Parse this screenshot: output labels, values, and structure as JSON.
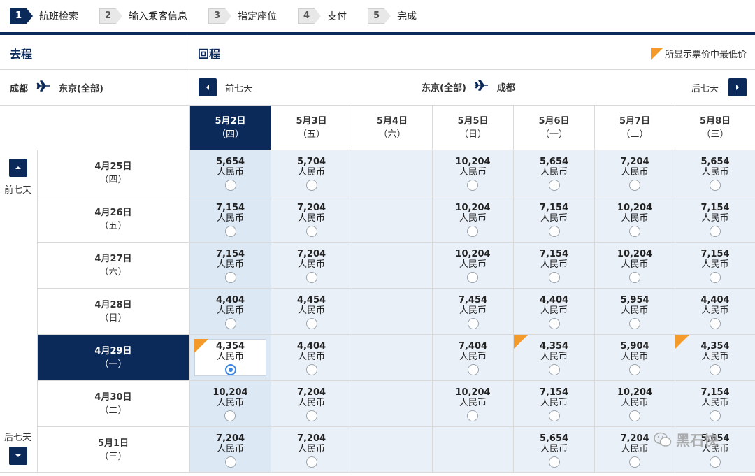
{
  "steps": [
    {
      "num": "1",
      "label": "航班检索",
      "active": true
    },
    {
      "num": "2",
      "label": "输入乘客信息",
      "active": false
    },
    {
      "num": "3",
      "label": "指定座位",
      "active": false
    },
    {
      "num": "4",
      "label": "支付",
      "active": false
    },
    {
      "num": "5",
      "label": "完成",
      "active": false
    }
  ],
  "outbound": {
    "title": "去程",
    "from": "成都",
    "to": "东京(全部)"
  },
  "return": {
    "title": "回程",
    "from": "东京(全部)",
    "to": "成都",
    "prev_label": "前七天",
    "next_label": "后七天"
  },
  "legend": {
    "label": "所显示票价中最低价",
    "color": "#f39a2b"
  },
  "side": {
    "prev_label": "前七天",
    "next_label": "后七天"
  },
  "return_dates": [
    {
      "date": "5月2日",
      "weekday": "（四）",
      "active": true
    },
    {
      "date": "5月3日",
      "weekday": "（五）",
      "active": false
    },
    {
      "date": "5月4日",
      "weekday": "（六）",
      "active": false
    },
    {
      "date": "5月5日",
      "weekday": "（日）",
      "active": false
    },
    {
      "date": "5月6日",
      "weekday": "（一）",
      "active": false
    },
    {
      "date": "5月7日",
      "weekday": "（二）",
      "active": false
    },
    {
      "date": "5月8日",
      "weekday": "（三）",
      "active": false
    }
  ],
  "currency": "人民币",
  "rows": [
    {
      "date": "4月25日",
      "weekday": "（四）",
      "active": false,
      "prices": [
        "5,654",
        "5,704",
        "",
        "10,204",
        "5,654",
        "7,204",
        "5,654"
      ]
    },
    {
      "date": "4月26日",
      "weekday": "（五）",
      "active": false,
      "prices": [
        "7,154",
        "7,204",
        "",
        "10,204",
        "7,154",
        "10,204",
        "7,154"
      ]
    },
    {
      "date": "4月27日",
      "weekday": "（六）",
      "active": false,
      "prices": [
        "7,154",
        "7,204",
        "",
        "10,204",
        "7,154",
        "10,204",
        "7,154"
      ]
    },
    {
      "date": "4月28日",
      "weekday": "（日）",
      "active": false,
      "prices": [
        "4,404",
        "4,454",
        "",
        "7,454",
        "4,404",
        "5,954",
        "4,404"
      ]
    },
    {
      "date": "4月29日",
      "weekday": "（一）",
      "active": true,
      "prices": [
        "4,354",
        "4,404",
        "",
        "7,404",
        "4,354",
        "5,904",
        "4,354"
      ],
      "lowest": [
        0,
        4,
        6
      ],
      "selected": 0
    },
    {
      "date": "4月30日",
      "weekday": "（二）",
      "active": false,
      "prices": [
        "10,204",
        "7,204",
        "",
        "10,204",
        "7,154",
        "10,204",
        "7,154"
      ]
    },
    {
      "date": "5月1日",
      "weekday": "（三）",
      "active": false,
      "prices": [
        "7,204",
        "7,204",
        "",
        "",
        "5,654",
        "7,204",
        "5,654"
      ]
    }
  ],
  "watermark": {
    "text": "黑石快",
    "icon": "wechat-icon"
  },
  "colors": {
    "navy": "#0b2a5a",
    "accent": "#f39a2b",
    "cell_bg": "#e9f0f8",
    "radio_selected": "#3a86e0"
  }
}
